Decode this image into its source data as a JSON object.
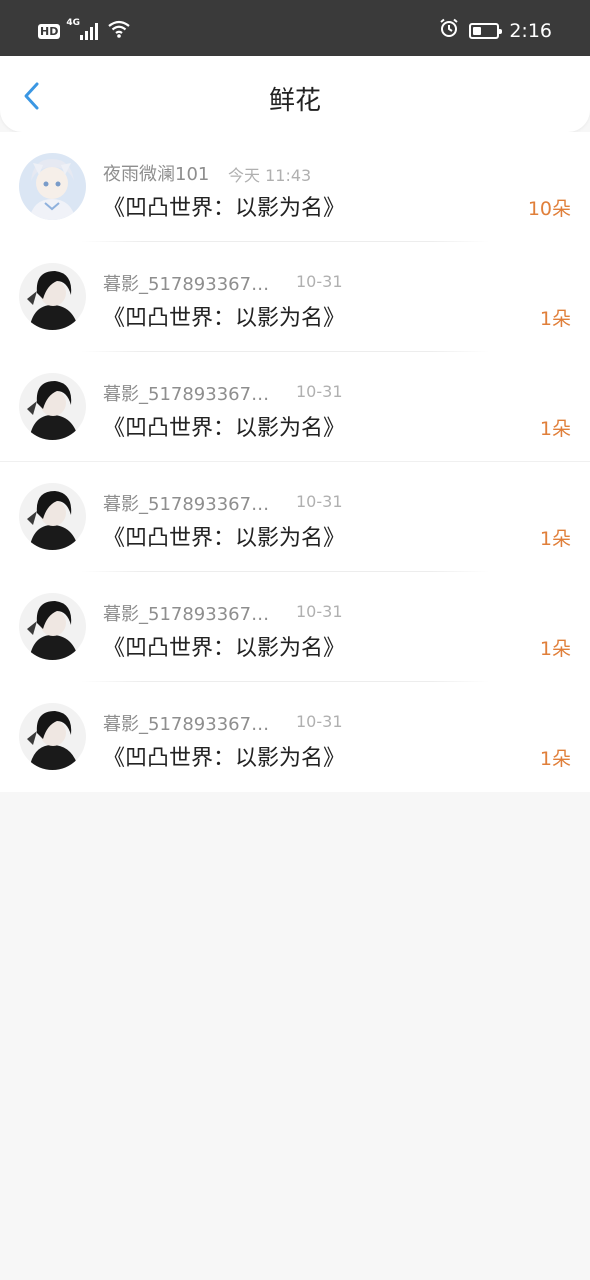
{
  "status_bar": {
    "hd": "HD",
    "network": "4G",
    "time": "2:16",
    "icons": [
      "hd-icon",
      "signal-icon",
      "wifi-icon",
      "alarm-icon",
      "battery-icon"
    ]
  },
  "header": {
    "title": "鲜花",
    "back_icon": "chevron-left-icon"
  },
  "colors": {
    "accent_blue": "#3b97e3",
    "count_orange": "#e07f3a",
    "status_bar_bg": "#3a3a3a"
  },
  "rows": [
    {
      "name": "夜雨微澜101",
      "time": "今天 11:43",
      "book": "《凹凸世界：以影为名》",
      "count": "10朵",
      "avatar": "anime-girl-avatar"
    },
    {
      "name": "暮影_5178933670…",
      "time": "10-31",
      "book": "《凹凸世界：以影为名》",
      "count": "1朵",
      "avatar": "dark-boy-avatar"
    },
    {
      "name": "暮影_5178933670…",
      "time": "10-31",
      "book": "《凹凸世界：以影为名》",
      "count": "1朵",
      "avatar": "dark-boy-avatar"
    },
    {
      "name": "暮影_5178933670…",
      "time": "10-31",
      "book": "《凹凸世界：以影为名》",
      "count": "1朵",
      "avatar": "dark-boy-avatar"
    },
    {
      "name": "暮影_5178933670…",
      "time": "10-31",
      "book": "《凹凸世界：以影为名》",
      "count": "1朵",
      "avatar": "dark-boy-avatar"
    },
    {
      "name": "暮影_5178933670…",
      "time": "10-31",
      "book": "《凹凸世界：以影为名》",
      "count": "1朵",
      "avatar": "dark-boy-avatar"
    }
  ]
}
